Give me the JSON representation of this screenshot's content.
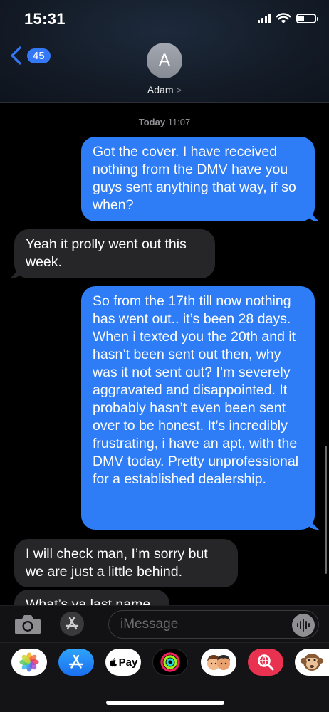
{
  "status_bar": {
    "time": "15:31"
  },
  "header": {
    "back_badge": "45",
    "contact_initial": "A",
    "contact_name": "Adam",
    "contact_chevron": ">"
  },
  "thread": {
    "timestamp_day": "Today",
    "timestamp_time": "11:07",
    "messages": [
      {
        "direction": "sent",
        "text": "Got the cover. I have received nothing from the DMV have you guys sent anything that way, if so when?"
      },
      {
        "direction": "received",
        "text": "Yeah it prolly went out this week."
      },
      {
        "direction": "sent",
        "text": "So from the 17th till now nothing has went out.. it’s been 28 days. When i texted you the 20th and it hasn’t been sent out then, why was it not sent out? I’m severely aggravated and disappointed. It probably hasn’t even been sent over to be honest. It’s incredibly frustrating, i have an apt, with the DMV today. Pretty unprofessional for a established dealership."
      },
      {
        "direction": "received",
        "text": "I will check man, I’m sorry but we are just a little behind."
      },
      {
        "direction": "received",
        "text": "What’s ya last name"
      }
    ]
  },
  "compose": {
    "placeholder": "iMessage"
  },
  "app_drawer": {
    "apple_pay_label": "Pay",
    "apps": [
      "photos-icon",
      "app-store-icon",
      "apple-pay-icon",
      "activity-icon",
      "memoji-icon",
      "web-search-icon",
      "animoji-monkey-icon"
    ]
  },
  "colors": {
    "sent_bubble": "#2f7df6",
    "received_bubble": "#262629",
    "accent": "#3478f6"
  }
}
